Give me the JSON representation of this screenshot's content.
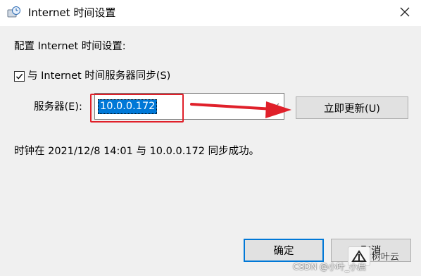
{
  "window": {
    "title": "Internet 时间设置",
    "icon": "clock-globe-icon",
    "close": "×"
  },
  "dialog": {
    "heading": "配置 Internet 时间设置:",
    "sync_checkbox": {
      "checked": true,
      "label": "与 Internet 时间服务器同步(S)"
    },
    "server_label": "服务器(E):",
    "server_value": "10.0.0.172",
    "update_button": "立即更新(U)",
    "status_text": "时钟在 2021/12/8 14:01 与 10.0.0.172 同步成功。",
    "ok_button": "确定",
    "cancel_button": "取消"
  },
  "annotation": {
    "color": "#e0202a"
  },
  "watermark": {
    "brand": "树叶云",
    "credit": "CSDN @小叶_小启"
  },
  "colors": {
    "accent": "#0078d7",
    "dialog_bg": "#f0f0f0",
    "button_bg": "#e1e1e1"
  }
}
